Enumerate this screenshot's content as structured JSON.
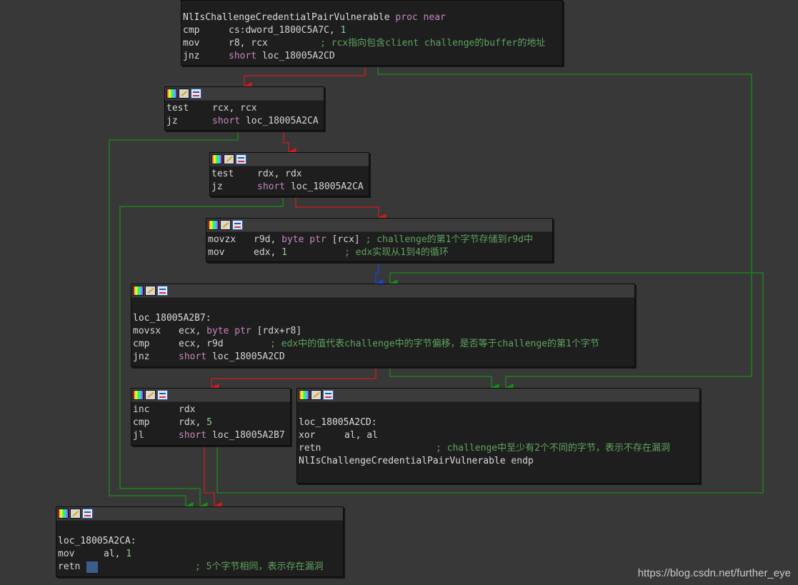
{
  "blocks": {
    "b0": {
      "proc_line": "NlIsChallengeCredentialPairVulnerable",
      "proc_kw": "proc near",
      "l1_op": "cmp",
      "l1_arg": "cs:dword_1800C5A7C, ",
      "l1_num": "1",
      "l2_op": "mov",
      "l2_arg": "r8, rcx",
      "l2_cm": "; rcx指向包含client challenge的buffer的地址",
      "l3_op": "jnz",
      "l3_kw": "short",
      "l3_arg": "loc_18005A2CD"
    },
    "b1": {
      "l1_op": "test",
      "l1_arg": "rcx, rcx",
      "l2_op": "jz",
      "l2_kw": "short",
      "l2_arg": "loc_18005A2CA"
    },
    "b2": {
      "l1_op": "test",
      "l1_arg": "rdx, rdx",
      "l2_op": "jz",
      "l2_kw": "short",
      "l2_arg": "loc_18005A2CA"
    },
    "b3": {
      "l1_op": "movzx",
      "l1_arg": "r9d, ",
      "l1_kw": "byte ptr",
      "l1_arg2": " [rcx]",
      "l1_cm": "; challenge的第1个字节存储到r9d中",
      "l2_op": "mov",
      "l2_arg": "edx, ",
      "l2_num": "1",
      "l2_cm": "; edx实现从1到4的循环"
    },
    "b4": {
      "label": "loc_18005A2B7:",
      "l1_op": "movsx",
      "l1_arg": "ecx, ",
      "l1_kw": "byte ptr",
      "l1_arg2": " [rdx+r8]",
      "l2_op": "cmp",
      "l2_arg": "ecx, r9d",
      "l2_cm": "; edx中的值代表challenge中的字节偏移，是否等于challenge的第1个字节",
      "l3_op": "jnz",
      "l3_kw": "short",
      "l3_arg": "loc_18005A2CD"
    },
    "b5": {
      "l1_op": "inc",
      "l1_arg": "rdx",
      "l2_op": "cmp",
      "l2_arg": "rdx, ",
      "l2_num": "5",
      "l3_op": "jl",
      "l3_kw": "short",
      "l3_arg": "loc_18005A2B7"
    },
    "b6": {
      "label": "loc_18005A2CD:",
      "l1_op": "xor",
      "l1_arg": "al, al",
      "l2_op": "retn",
      "l2_cm": "; challenge中至少有2个不同的字节，表示不存在漏洞",
      "endp_name": "NlIsChallengeCredentialPairVulnerable",
      "endp_kw": "endp"
    },
    "b7": {
      "label": "loc_18005A2CA:",
      "l1_op": "mov",
      "l1_arg": "al, ",
      "l1_num": "1",
      "l2_op": "retn",
      "l2_cm": "; 5个字节相同，表示存在漏洞"
    }
  },
  "watermark": "https://blog.csdn.net/further_eye",
  "colors": {
    "background": "#383838",
    "node_bg": "#1e1e1e",
    "edge_true": "#1a8c1a",
    "edge_false": "#d01c1c",
    "edge_uncond": "#1f3fe0",
    "keyword": "#c586c0",
    "comment": "#5fa35f",
    "number": "#8ecb8e"
  },
  "header_icons": [
    "color-palette-icon",
    "edit-icon",
    "graph-overview-icon"
  ]
}
